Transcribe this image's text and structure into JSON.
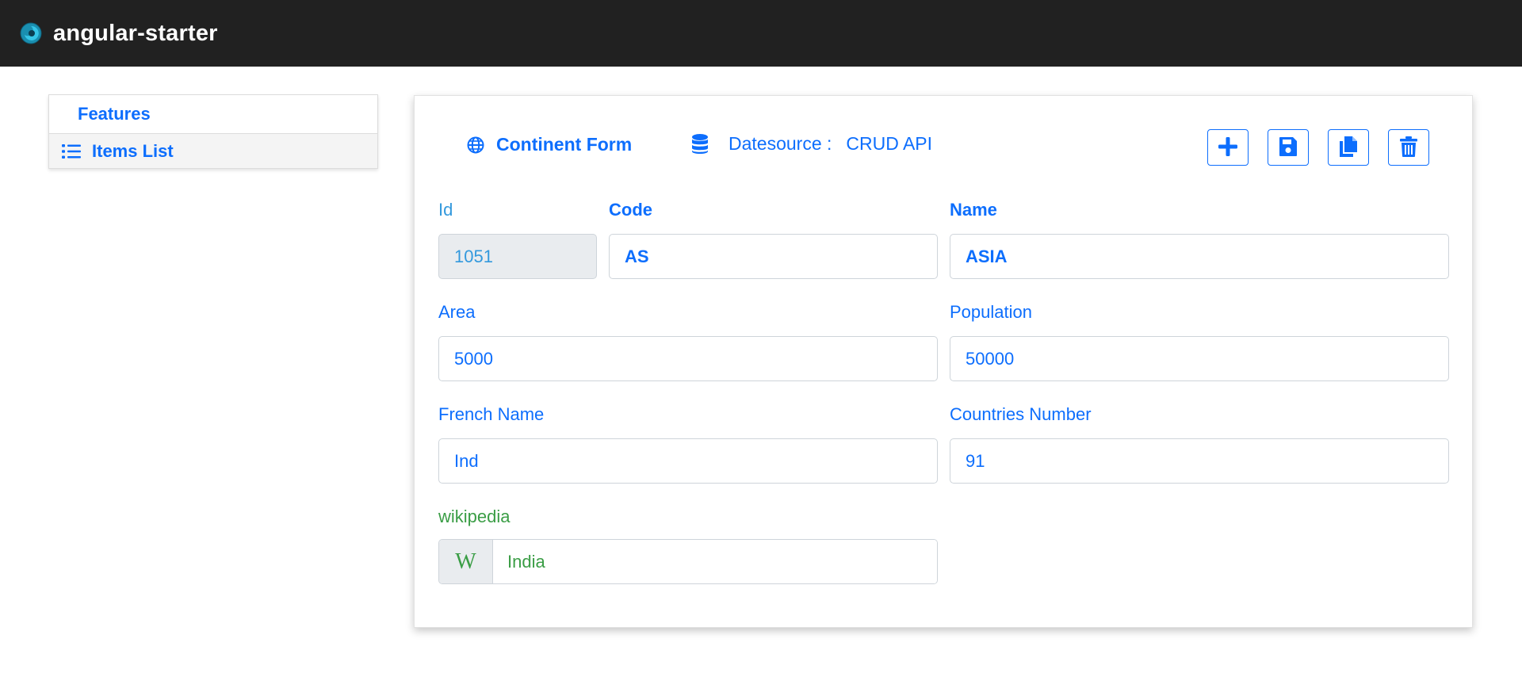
{
  "app": {
    "title": "angular-starter"
  },
  "sidebar": {
    "header": "Features",
    "items": [
      {
        "label": "Items List"
      }
    ]
  },
  "form": {
    "title": "Continent Form",
    "datasource_label": "Datesource :",
    "datasource_value": "CRUD API",
    "fields": {
      "id": {
        "label": "Id",
        "value": "1051"
      },
      "code": {
        "label": "Code",
        "value": "AS"
      },
      "name": {
        "label": "Name",
        "value": "ASIA"
      },
      "area": {
        "label": "Area",
        "value": "5000"
      },
      "population": {
        "label": "Population",
        "value": "50000"
      },
      "french_name": {
        "label": "French Name",
        "value": "Ind"
      },
      "countries_number": {
        "label": "Countries Number",
        "value": "91"
      },
      "wikipedia": {
        "label": "wikipedia",
        "addon": "W",
        "value": "India"
      }
    }
  },
  "toolbar": {
    "buttons": [
      "add-icon",
      "save-icon",
      "copy-icon",
      "delete-icon"
    ]
  },
  "colors": {
    "navbar": "#212121",
    "accent": "#0d6efd",
    "id_text": "#3399dd",
    "wiki_green": "#3a9d45"
  }
}
